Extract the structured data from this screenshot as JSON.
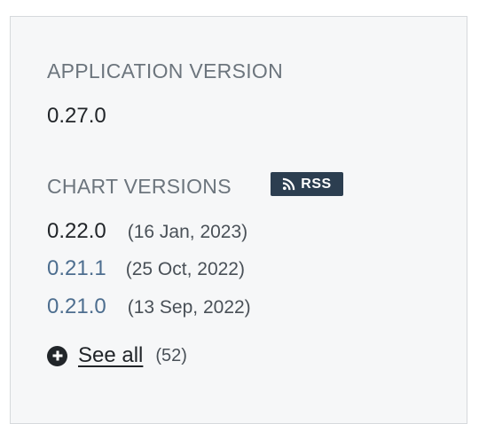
{
  "application_version": {
    "title": "APPLICATION VERSION",
    "value": "0.27.0"
  },
  "chart_versions": {
    "title": "CHART VERSIONS",
    "rss_label": "RSS",
    "items": [
      {
        "version": "0.22.0",
        "date": "(16 Jan, 2023)",
        "current": true
      },
      {
        "version": "0.21.1",
        "date": "(25 Oct, 2022)",
        "current": false
      },
      {
        "version": "0.21.0",
        "date": "(13 Sep, 2022)",
        "current": false
      }
    ],
    "see_all_label": "See all",
    "see_all_count": "(52)"
  },
  "colors": {
    "link": "#4d6e8f",
    "text": "#212529",
    "badge": "#2c3e50"
  }
}
